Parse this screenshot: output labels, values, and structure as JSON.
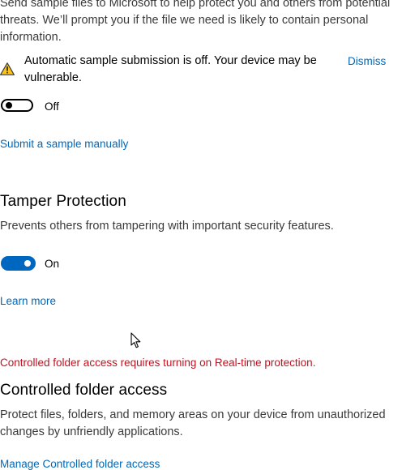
{
  "sample_submission": {
    "description": "Send sample files to Microsoft to help protect you and others from potential threats. We’ll prompt you if the file we need is likely to contain personal information.",
    "warning_icon": "warning-icon",
    "warning_text": "Automatic sample submission is off. Your device may be vulnerable.",
    "dismiss_label": "Dismiss",
    "toggle_state": "Off",
    "submit_link": "Submit a sample manually"
  },
  "tamper_protection": {
    "title": "Tamper Protection",
    "description": "Prevents others from tampering with important security features.",
    "toggle_state": "On",
    "learn_more_link": "Learn more"
  },
  "controlled_folder_access": {
    "error_text": "Controlled folder access requires turning on Real-time protection.",
    "title": "Controlled folder access",
    "description": "Protect files, folders, and memory areas on your device from unauthorized changes by unfriendly applications.",
    "manage_link": "Manage Controlled folder access"
  },
  "colors": {
    "accent": "#0067c0",
    "link": "#0067b8",
    "error": "#c50f1f",
    "warning": "#fcc419"
  },
  "cursor_icon": "mouse-pointer-icon"
}
